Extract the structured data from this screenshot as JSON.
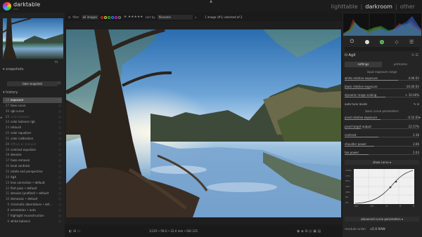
{
  "app": {
    "name": "darktable",
    "version": "4.6.1"
  },
  "views": {
    "lighttable": "lighttable",
    "darkroom": "darkroom",
    "other": "other"
  },
  "filterbar": {
    "filter_label": "filter",
    "filter_value": "all images",
    "sort_label": "sort by",
    "sort_value": "filename",
    "selection_text": "1 image (#1) selected of 2"
  },
  "left": {
    "thumb_caption": "fit",
    "snapshots_title": "snapshots",
    "take_snapshot": "take snapshot",
    "history_title": "history",
    "history": [
      {
        "n": "28",
        "label": "exposure",
        "selected": true
      },
      {
        "n": "27",
        "label": "tone curve"
      },
      {
        "n": "26",
        "label": "rgb curve"
      },
      {
        "n": "25",
        "label": "color balance",
        "dim": true
      },
      {
        "n": "24",
        "label": "color balance rgb"
      },
      {
        "n": "23",
        "label": "retouch"
      },
      {
        "n": "22",
        "label": "color equalizer"
      },
      {
        "n": "21",
        "label": "color calibration"
      },
      {
        "n": "20",
        "label": "diffuse or sharpen",
        "dim": true
      },
      {
        "n": "19",
        "label": "contrast equalizer"
      },
      {
        "n": "18",
        "label": "denoise"
      },
      {
        "n": "17",
        "label": "haze removal"
      },
      {
        "n": "16",
        "label": "local contrast"
      },
      {
        "n": "15",
        "label": "rotate and perspective"
      },
      {
        "n": "14",
        "label": "AgX"
      },
      {
        "n": "13",
        "label": "lens correction • default"
      },
      {
        "n": "12",
        "label": "first pass • default"
      },
      {
        "n": "11",
        "label": "denoise (profiled) • default"
      },
      {
        "n": "10",
        "label": "demosaic • default"
      },
      {
        "n": "9",
        "label": "chromatic aberrations • def..."
      },
      {
        "n": "8",
        "label": "orientation • auto"
      },
      {
        "n": "7",
        "label": "highlight reconstruction"
      },
      {
        "n": "6",
        "label": "white balance"
      }
    ]
  },
  "bottombar": {
    "exif": "1/125 • f/8.0 • 22.0 mm • ISO 125"
  },
  "right": {
    "module_name": "AgX",
    "tab_settings": "settings",
    "tab_primaries": "primaries",
    "section_input": "input exposure range",
    "sliders_input": [
      {
        "label": "white relative exposure",
        "value": "4.06 EV",
        "frac": 0.72
      },
      {
        "label": "black relative exposure",
        "value": "-10.00 EV",
        "frac": 0.35
      },
      {
        "label": "dynamic range scaling",
        "value": "+ 10.00%",
        "frac": 0.55
      }
    ],
    "auto_tune": "auto tune levels",
    "section_curve": "basic curve parameters",
    "sliders_curve": [
      {
        "label": "pivot relative exposure",
        "value": "-0.52 EV",
        "frac": 0.48
      },
      {
        "label": "pivot target output",
        "value": "22.57%",
        "frac": 0.22
      },
      {
        "label": "contrast",
        "value": "2.36",
        "frac": 0.45
      },
      {
        "label": "shoulder power",
        "value": "2.66",
        "frac": 0.4
      },
      {
        "label": "toe power",
        "value": "2.03",
        "frac": 0.32
      }
    ],
    "show_curve": "show curve",
    "curve_ylabels": [
      "100%",
      "77%",
      "55%",
      "33%",
      "18%",
      "9%",
      "0%"
    ],
    "curve_xlabels": [
      "-15",
      "-10",
      "-5",
      "0",
      "5"
    ],
    "advanced": "advanced curve parameters",
    "module_order_label": "module order",
    "module_order_value": "v5.0 RAW"
  },
  "colors": {
    "accent": "#dddddd",
    "histogram_red": "#d44",
    "histogram_green": "#4c4",
    "histogram_blue": "#48f"
  }
}
